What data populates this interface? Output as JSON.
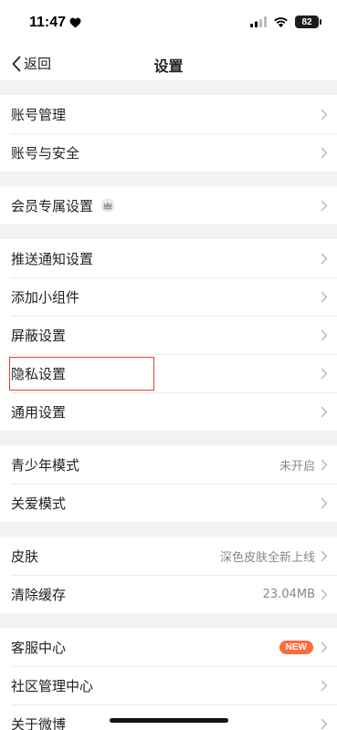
{
  "status_bar": {
    "time": "11:47",
    "battery": "82"
  },
  "navbar": {
    "back_label": "返回",
    "title": "设置"
  },
  "sections": [
    [
      {
        "label": "账号管理"
      },
      {
        "label": "账号与安全"
      }
    ],
    [
      {
        "label": "会员专属设置",
        "icon": "crown-badge-icon"
      }
    ],
    [
      {
        "label": "推送通知设置"
      },
      {
        "label": "添加小组件"
      },
      {
        "label": "屏蔽设置"
      },
      {
        "label": "隐私设置",
        "highlighted": true
      },
      {
        "label": "通用设置"
      }
    ],
    [
      {
        "label": "青少年模式",
        "value": "未开启"
      },
      {
        "label": "关爱模式"
      }
    ],
    [
      {
        "label": "皮肤",
        "value": "深色皮肤全新上线"
      },
      {
        "label": "清除缓存",
        "value": "23.04MB"
      }
    ],
    [
      {
        "label": "客服中心",
        "badge": "NEW"
      },
      {
        "label": "社区管理中心"
      },
      {
        "label": "关于微博"
      }
    ]
  ],
  "colors": {
    "accent": "#ff6a3d",
    "highlight_border": "#e0443a",
    "background": "#f2f2f4"
  }
}
